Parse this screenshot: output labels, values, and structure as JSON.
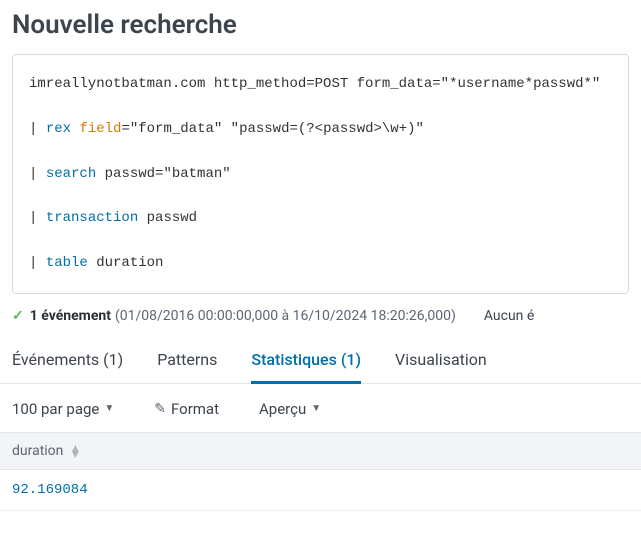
{
  "header": {
    "title": "Nouvelle recherche"
  },
  "search": {
    "line1_text": "imreallynotbatman.com http_method=POST form_data=\"*username*passwd*\"",
    "rex_cmd": "rex",
    "rex_field_kw": "field",
    "rex_field_val": "=\"form_data\" \"passwd=(?<passwd>\\w+)\"",
    "search_cmd": "search",
    "search_args": " passwd=\"batman\"",
    "transaction_cmd": "transaction",
    "transaction_args": " passwd",
    "table_cmd": "table",
    "table_args": " duration"
  },
  "status": {
    "count_label": "1 événement",
    "time_range": "(01/08/2016 00:00:00,000 à 16/10/2024 18:20:26,000)",
    "right_text": "Aucun é"
  },
  "tabs": {
    "events": "Événements (1)",
    "patterns": "Patterns",
    "statistics": "Statistiques (1)",
    "visualization": "Visualisation"
  },
  "toolbar": {
    "per_page": "100 par page",
    "format": "Format",
    "preview": "Aperçu"
  },
  "table": {
    "column_header": "duration",
    "rows": [
      "92.169084"
    ]
  }
}
